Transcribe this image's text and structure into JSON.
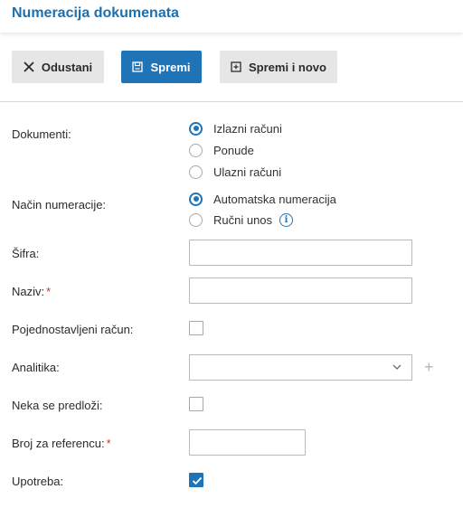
{
  "page": {
    "title": "Numeracija dokumenata"
  },
  "toolbar": {
    "cancel_label": "Odustani",
    "save_label": "Spremi",
    "save_new_label": "Spremi i novo"
  },
  "form": {
    "documents": {
      "label": "Dokumenti:",
      "options": [
        "Izlazni računi",
        "Ponude",
        "Ulazni računi"
      ],
      "selected": "Izlazni računi"
    },
    "numbering_method": {
      "label": "Način numeracije:",
      "options": [
        "Automatska numeracija",
        "Ručni unos"
      ],
      "selected": "Automatska numeracija"
    },
    "code": {
      "label": "Šifra:",
      "value": ""
    },
    "name": {
      "label": "Naziv:",
      "value": "",
      "required": true
    },
    "simplified_invoice": {
      "label": "Pojednostavljeni račun:",
      "checked": false
    },
    "analytics": {
      "label": "Analitika:",
      "value": ""
    },
    "do_not_suggest": {
      "label": "Neka se predloži:",
      "checked": false
    },
    "reference_number": {
      "label": "Broj za referencu:",
      "value": "",
      "required": true
    },
    "usage": {
      "label": "Upotreba:",
      "checked": true
    }
  },
  "colors": {
    "accent": "#1f74b8",
    "required": "#d0312d"
  }
}
